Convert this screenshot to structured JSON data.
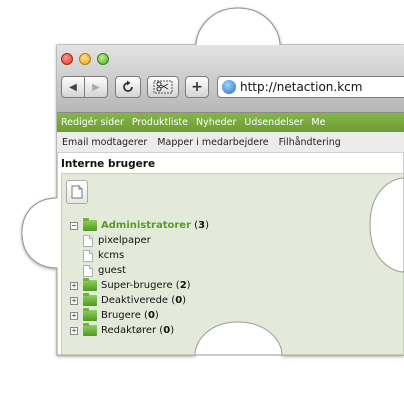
{
  "browser": {
    "toolbar": {
      "back_label": "◀",
      "forward_label": "▶",
      "add_label": "+",
      "url": "http://netaction.kcm"
    }
  },
  "app": {
    "main_nav": [
      "Redigér sider",
      "Produktliste",
      "Nyheder",
      "Udsendelser",
      "Me"
    ],
    "sub_nav": [
      "Email modtagerer",
      "Mapper i medarbejdere",
      "Filhåndtering"
    ],
    "section_title": "Interne brugere",
    "tree": {
      "root": {
        "label": "Administratorer",
        "count": "3"
      },
      "root_children": [
        "pixelpaper",
        "kcms",
        "guest"
      ],
      "groups": [
        {
          "label": "Super-brugere",
          "count": "2"
        },
        {
          "label": "Deaktiverede",
          "count": "0"
        },
        {
          "label": "Brugere",
          "count": "0"
        },
        {
          "label": "Redaktører",
          "count": "0"
        }
      ]
    }
  },
  "colors": {
    "nav_green": "#7aaa3e",
    "panel_bg": "#e3ead9",
    "folder_green": "#5fa82c",
    "admin_text": "#5a9b25"
  },
  "icons": {
    "new_document": "new-document-icon",
    "folder": "folder-icon",
    "page": "page-icon",
    "expand": "expand-icon",
    "collapse": "collapse-icon"
  }
}
